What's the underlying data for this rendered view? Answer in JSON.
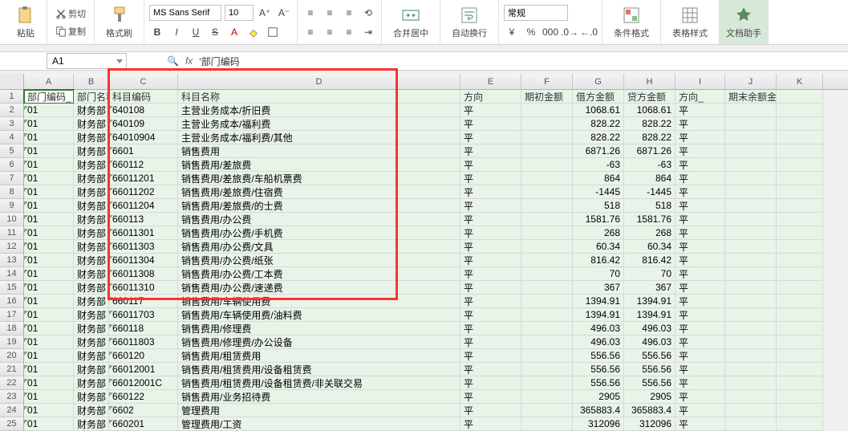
{
  "ribbon": {
    "paste": "粘贴",
    "cut": "剪切",
    "copy": "复制",
    "format_painter": "格式刷",
    "font_name": "MS Sans Serif",
    "font_size": "10",
    "merge_center": "合并居中",
    "wrap_text": "自动换行",
    "number_format": "常规",
    "cond_format": "条件格式",
    "table_style": "表格样式",
    "doc_helper": "文档助手"
  },
  "namebox": "A1",
  "formula": "'部门编码",
  "columns": [
    "A",
    "B",
    "C",
    "D",
    "E",
    "F",
    "G",
    "H",
    "I",
    "J",
    "K"
  ],
  "headers": [
    "部门编码_",
    "部门名称",
    "科目编码",
    "科目名称",
    "方向",
    "期初金额",
    "借方金额",
    "贷方金额",
    "方向_",
    "期末余额金额"
  ],
  "rows": [
    [
      "01",
      "财务部",
      "640108",
      "主营业务成本/折旧费",
      "平",
      "",
      "1068.61",
      "1068.61",
      "平",
      ""
    ],
    [
      "01",
      "财务部",
      "640109",
      "主营业务成本/福利费",
      "平",
      "",
      "828.22",
      "828.22",
      "平",
      ""
    ],
    [
      "01",
      "财务部",
      "64010904",
      "主营业务成本/福利费/其他",
      "平",
      "",
      "828.22",
      "828.22",
      "平",
      ""
    ],
    [
      "01",
      "财务部",
      "6601",
      "销售费用",
      "平",
      "",
      "6871.26",
      "6871.26",
      "平",
      ""
    ],
    [
      "01",
      "财务部",
      "660112",
      "销售费用/差旅费",
      "平",
      "",
      "-63",
      "-63",
      "平",
      ""
    ],
    [
      "01",
      "财务部",
      "66011201",
      "销售费用/差旅费/车船机票费",
      "平",
      "",
      "864",
      "864",
      "平",
      ""
    ],
    [
      "01",
      "财务部",
      "66011202",
      "销售费用/差旅费/住宿费",
      "平",
      "",
      "-1445",
      "-1445",
      "平",
      ""
    ],
    [
      "01",
      "财务部",
      "66011204",
      "销售费用/差旅费/的士费",
      "平",
      "",
      "518",
      "518",
      "平",
      ""
    ],
    [
      "01",
      "财务部",
      "660113",
      "销售费用/办公费",
      "平",
      "",
      "1581.76",
      "1581.76",
      "平",
      ""
    ],
    [
      "01",
      "财务部",
      "66011301",
      "销售费用/办公费/手机费",
      "平",
      "",
      "268",
      "268",
      "平",
      ""
    ],
    [
      "01",
      "财务部",
      "66011303",
      "销售费用/办公费/文具",
      "平",
      "",
      "60.34",
      "60.34",
      "平",
      ""
    ],
    [
      "01",
      "财务部",
      "66011304",
      "销售费用/办公费/纸张",
      "平",
      "",
      "816.42",
      "816.42",
      "平",
      ""
    ],
    [
      "01",
      "财务部",
      "66011308",
      "销售费用/办公费/工本费",
      "平",
      "",
      "70",
      "70",
      "平",
      ""
    ],
    [
      "01",
      "财务部",
      "66011310",
      "销售费用/办公费/速递费",
      "平",
      "",
      "367",
      "367",
      "平",
      ""
    ],
    [
      "01",
      "财务部",
      "660117",
      "销售费用/车辆使用费",
      "平",
      "",
      "1394.91",
      "1394.91",
      "平",
      ""
    ],
    [
      "01",
      "财务部",
      "66011703",
      "销售费用/车辆使用费/油料费",
      "平",
      "",
      "1394.91",
      "1394.91",
      "平",
      ""
    ],
    [
      "01",
      "财务部",
      "660118",
      "销售费用/修理费",
      "平",
      "",
      "496.03",
      "496.03",
      "平",
      ""
    ],
    [
      "01",
      "财务部",
      "66011803",
      "销售费用/修理费/办公设备",
      "平",
      "",
      "496.03",
      "496.03",
      "平",
      ""
    ],
    [
      "01",
      "财务部",
      "660120",
      "销售费用/租赁费用",
      "平",
      "",
      "556.56",
      "556.56",
      "平",
      ""
    ],
    [
      "01",
      "财务部",
      "66012001",
      "销售费用/租赁费用/设备租赁费",
      "平",
      "",
      "556.56",
      "556.56",
      "平",
      ""
    ],
    [
      "01",
      "财务部",
      "66012001C",
      "销售费用/租赁费用/设备租赁费/非关联交易",
      "平",
      "",
      "556.56",
      "556.56",
      "平",
      ""
    ],
    [
      "01",
      "财务部",
      "660122",
      "销售费用/业务招待费",
      "平",
      "",
      "2905",
      "2905",
      "平",
      ""
    ],
    [
      "01",
      "财务部",
      "6602",
      "管理费用",
      "平",
      "",
      "365883.4",
      "365883.4",
      "平",
      ""
    ],
    [
      "01",
      "财务部",
      "660201",
      "管理费用/工资",
      "平",
      "",
      "312096",
      "312096",
      "平",
      ""
    ]
  ]
}
